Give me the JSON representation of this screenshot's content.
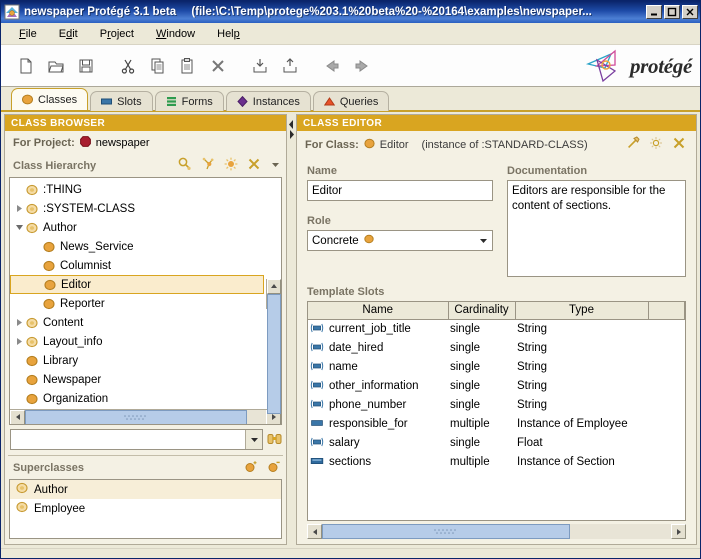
{
  "window": {
    "title": "newspaper  Protégé 3.1 beta",
    "path": "(file:\\C:\\Temp\\protege%203.1%20beta%20-%20164\\examples\\newspaper...",
    "minimize": "_",
    "maximize": "□",
    "close": "✕"
  },
  "menubar": [
    {
      "label": "File",
      "mnemonic": "F"
    },
    {
      "label": "Edit",
      "mnemonic": "E"
    },
    {
      "label": "Project",
      "mnemonic": "P"
    },
    {
      "label": "Window",
      "mnemonic": "W"
    },
    {
      "label": "Help",
      "mnemonic": "H"
    }
  ],
  "toolbar": {
    "buttons": [
      {
        "name": "new-project-icon",
        "title": "New Project"
      },
      {
        "name": "open-project-icon",
        "title": "Open Project"
      },
      {
        "name": "save-project-icon",
        "title": "Save Project"
      },
      {
        "name": "cut-icon",
        "title": "Cut"
      },
      {
        "name": "copy-icon",
        "title": "Copy"
      },
      {
        "name": "paste-icon",
        "title": "Paste"
      },
      {
        "name": "delete-icon",
        "title": "Delete"
      },
      {
        "name": "import-icon",
        "title": "Import"
      },
      {
        "name": "export-icon",
        "title": "Export"
      },
      {
        "name": "undo-icon",
        "title": "Undo"
      },
      {
        "name": "redo-icon",
        "title": "Redo"
      }
    ],
    "logo_text": "protégé"
  },
  "tabs": [
    {
      "label": "Classes",
      "icon": "class-icon",
      "active": true
    },
    {
      "label": "Slots",
      "icon": "slot-icon",
      "active": false
    },
    {
      "label": "Forms",
      "icon": "form-icon",
      "active": false
    },
    {
      "label": "Instances",
      "icon": "instance-icon",
      "active": false
    },
    {
      "label": "Queries",
      "icon": "query-icon",
      "active": false
    }
  ],
  "class_browser": {
    "header": "CLASS BROWSER",
    "for_project_label": "For Project:",
    "project_name": "newspaper",
    "hierarchy_label": "Class Hierarchy",
    "hierarchy_icons": [
      "find-class-icon",
      "create-subclass-icon",
      "create-class-icon",
      "delete-class-icon",
      "dropdown-arrow-icon"
    ],
    "tree": [
      {
        "label": ":THING",
        "depth": 0,
        "twisty": "none",
        "icon": "abstract-class-icon",
        "selected": false
      },
      {
        "label": ":SYSTEM-CLASS",
        "depth": 0,
        "twisty": "collapsed",
        "icon": "abstract-class-icon",
        "selected": false
      },
      {
        "label": "Author",
        "depth": 0,
        "twisty": "expanded",
        "icon": "abstract-class-icon",
        "selected": false
      },
      {
        "label": "News_Service",
        "depth": 1,
        "twisty": "none",
        "icon": "concrete-class-icon",
        "selected": false
      },
      {
        "label": "Columnist",
        "depth": 1,
        "twisty": "none",
        "icon": "concrete-class-icon",
        "selected": false
      },
      {
        "label": "Editor",
        "depth": 1,
        "twisty": "none",
        "icon": "concrete-class-icon",
        "selected": true
      },
      {
        "label": "Reporter",
        "depth": 1,
        "twisty": "none",
        "icon": "concrete-class-icon",
        "selected": false
      },
      {
        "label": "Content",
        "depth": 0,
        "twisty": "collapsed",
        "icon": "abstract-class-icon",
        "selected": false
      },
      {
        "label": "Layout_info",
        "depth": 0,
        "twisty": "collapsed",
        "icon": "abstract-class-icon",
        "selected": false
      },
      {
        "label": "Library",
        "depth": 0,
        "twisty": "none",
        "icon": "concrete-class-icon",
        "selected": false
      },
      {
        "label": "Newspaper",
        "depth": 0,
        "twisty": "none",
        "icon": "concrete-class-icon",
        "selected": false
      },
      {
        "label": "Organization",
        "depth": 0,
        "twisty": "none",
        "icon": "concrete-class-icon",
        "selected": false
      }
    ],
    "search_value": "",
    "search_placeholder": "",
    "find_icon": "binoculars-icon",
    "superclasses_label": "Superclasses",
    "superclasses_icons": [
      "add-superclass-icon",
      "remove-superclass-icon"
    ],
    "superclasses": [
      {
        "label": "Author",
        "selected": true
      },
      {
        "label": "Employee",
        "selected": false
      }
    ]
  },
  "class_editor": {
    "header": "CLASS EDITOR",
    "for_class_label": "For Class:",
    "class_name": "Editor",
    "instance_of": "(instance of :STANDARD-CLASS)",
    "header_icons": [
      "constraints-icon",
      "properties-icon",
      "close-icon"
    ],
    "name_label": "Name",
    "name_value": "Editor",
    "role_label": "Role",
    "role_value": "Concrete",
    "documentation_label": "Documentation",
    "documentation_value": "Editors are responsible for the content of sections.",
    "slots_label": "Template Slots",
    "columns": [
      "Name",
      "Cardinality",
      "Type",
      ""
    ],
    "slots": [
      {
        "name": "current_job_title",
        "cardinality": "single",
        "type": "String",
        "icon": "inherited-slot-icon"
      },
      {
        "name": "date_hired",
        "cardinality": "single",
        "type": "String",
        "icon": "inherited-slot-icon"
      },
      {
        "name": "name",
        "cardinality": "single",
        "type": "String",
        "icon": "inherited-slot-icon"
      },
      {
        "name": "other_information",
        "cardinality": "single",
        "type": "String",
        "icon": "inherited-slot-icon"
      },
      {
        "name": "phone_number",
        "cardinality": "single",
        "type": "String",
        "icon": "inherited-slot-icon"
      },
      {
        "name": "responsible_for",
        "cardinality": "multiple",
        "type": "Instance of Employee",
        "icon": "own-slot-icon"
      },
      {
        "name": "salary",
        "cardinality": "single",
        "type": "Float",
        "icon": "inherited-slot-icon"
      },
      {
        "name": "sections",
        "cardinality": "multiple",
        "type": "Instance of Section",
        "icon": "direct-slot-icon"
      }
    ]
  },
  "colors": {
    "title_bar": "#0a246a",
    "pane_header": "#d9a520",
    "accent_gold": "#c8a02a",
    "selection_fill": "#faeccd",
    "slot_blue": "#3a76a8",
    "class_orange": "#e8a33d",
    "project_red": "#a81e2e",
    "scroll_thumb": "#b6cce8"
  }
}
